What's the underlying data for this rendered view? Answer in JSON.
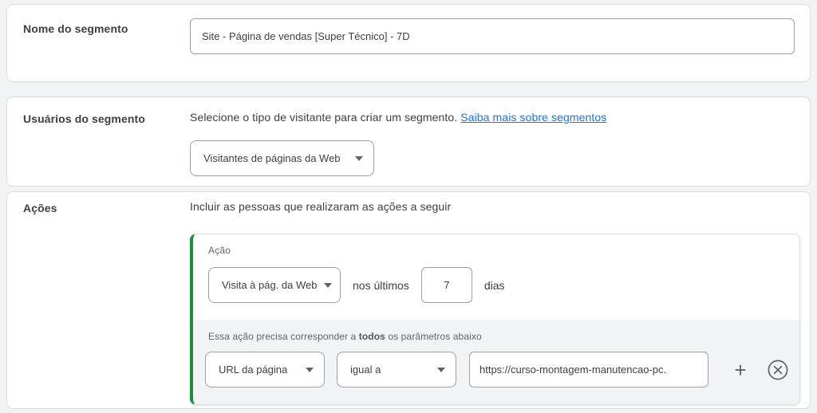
{
  "colors": {
    "page_background": "#f1f3f4",
    "card_border": "#dadce0",
    "accent_green": "#1e8e3e",
    "link_blue": "#1a73e8",
    "icon_gray": "#5f6368"
  },
  "segment_name": {
    "label": "Nome do segmento",
    "value": "Site - Página de vendas [Super Técnico] - 7D"
  },
  "segment_users": {
    "label": "Usuários do segmento",
    "description": "Selecione o tipo de visitante para criar um segmento. ",
    "link": "Saiba mais sobre segmentos",
    "visitor_type_dropdown": "Visitantes de páginas da Web"
  },
  "actions": {
    "label": "Ações",
    "description": "Incluir as pessoas que realizaram as ações a seguir",
    "action_card": {
      "action_label": "Ação",
      "action_type_dropdown": "Visita à pág. da Web",
      "lookback_prefix": "nos últimos",
      "lookback_value": "7",
      "lookback_suffix": "dias",
      "match_rule_prefix": "Essa ação precisa corresponder a ",
      "match_rule_bold": "todos",
      "match_rule_suffix": " os parâmetros abaixo",
      "param_field_dropdown": "URL da página",
      "param_operator_dropdown": "igual a",
      "param_value": "https://curso-montagem-manutencao-pc.",
      "add_icon_glyph": "+"
    }
  }
}
